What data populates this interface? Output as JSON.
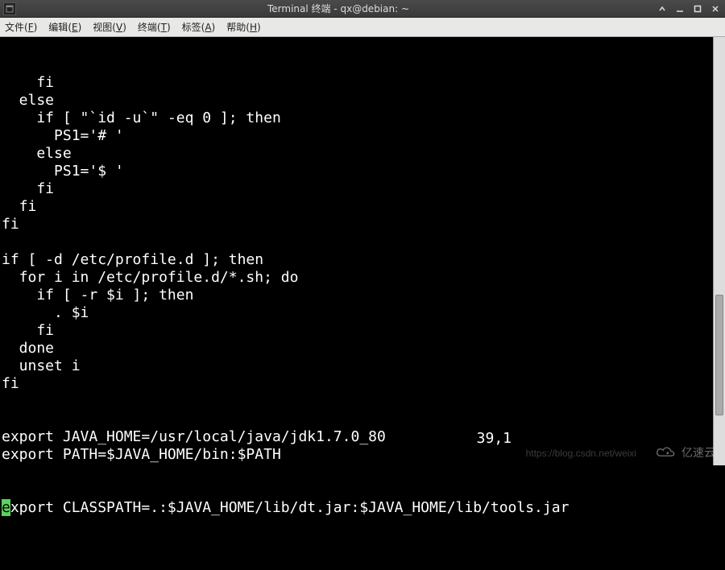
{
  "window": {
    "title": "Terminal 终端 - qx@debian: ~"
  },
  "menu": {
    "file": {
      "label": "文件",
      "accel": "F"
    },
    "edit": {
      "label": "编辑",
      "accel": "E"
    },
    "view": {
      "label": "视图",
      "accel": "V"
    },
    "terminal": {
      "label": "终端",
      "accel": "T"
    },
    "tabs": {
      "label": "标签",
      "accel": "A"
    },
    "help": {
      "label": "帮助",
      "accel": "H"
    }
  },
  "terminal": {
    "lines": [
      "    fi",
      "  else",
      "    if [ \"`id -u`\" -eq 0 ]; then",
      "      PS1='# '",
      "    else",
      "      PS1='$ '",
      "    fi",
      "  fi",
      "fi",
      "",
      "if [ -d /etc/profile.d ]; then",
      "  for i in /etc/profile.d/*.sh; do",
      "    if [ -r $i ]; then",
      "      . $i",
      "    fi",
      "  done",
      "  unset i",
      "fi",
      "",
      "",
      "export JAVA_HOME=/usr/local/java/jdk1.7.0_80",
      "export PATH=$JAVA_HOME/bin:$PATH"
    ],
    "cursor_line_prefix": "e",
    "cursor_line_rest": "xport CLASSPATH=.:$JAVA_HOME/lib/dt.jar:$JAVA_HOME/lib/tools.jar",
    "vim_position": "39,1"
  },
  "watermark": {
    "url": "https://blog.csdn.net/weixi",
    "brand": "亿速云"
  }
}
